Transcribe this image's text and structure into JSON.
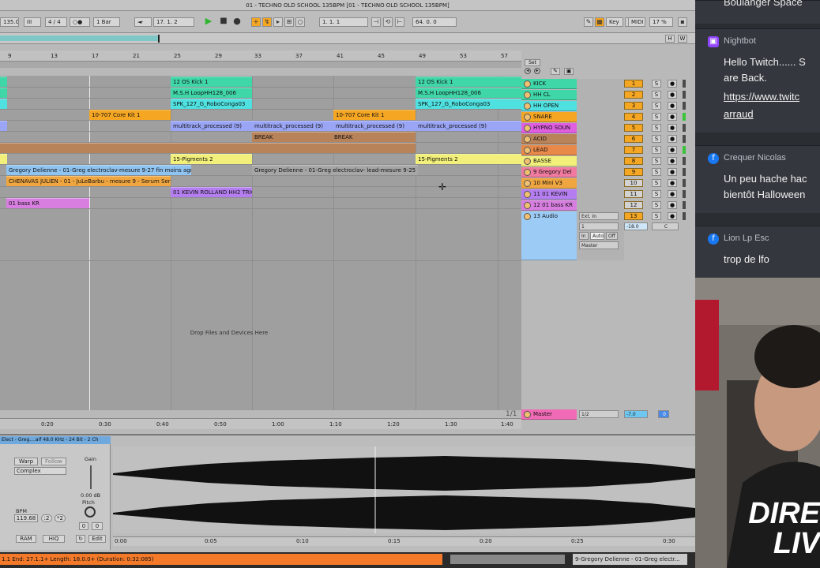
{
  "title": "01 - TECHNO OLD SCHOOL 135BPM  [01 - TECHNO OLD SCHOOL 135BPM]",
  "transport": {
    "tempo": "135.00",
    "signature": "4 / 4",
    "quantize": "1 Bar",
    "position": "17.  1.  2",
    "loop_start": "1.  1.  1",
    "loop_length": "64.  0.  0",
    "key_label": "Key",
    "midi_label": "MIDI",
    "cpu": "17 %",
    "h_label": "H",
    "w_label": "W",
    "play_icon": "play-icon",
    "stop_icon": "stop-icon",
    "record_icon": "record-icon"
  },
  "ruler": [
    "9",
    "13",
    "17",
    "21",
    "25",
    "29",
    "33",
    "37",
    "41",
    "45",
    "49",
    "53",
    "57"
  ],
  "set_label": "Set",
  "clips": [
    {
      "text": "12 OS Kick 1",
      "color": "#3fd6a8"
    },
    {
      "text": "12 OS Kick 1",
      "color": "#3fd6a8"
    },
    {
      "text": "M.S.H LoopHH128_006",
      "color": "#3fd6a8"
    },
    {
      "text": "M.S.H LoopHH128_006",
      "color": "#3fd6a8"
    },
    {
      "text": "SPK_127_G_RoboConga03",
      "color": "#4fe0e0"
    },
    {
      "text": "SPK_127_G_RoboConga03",
      "color": "#4fe0e0"
    },
    {
      "text": "10-707 Core Kit 1",
      "color": "#f5a623"
    },
    {
      "text": "10-707 Core Kit 1",
      "color": "#f5a623"
    },
    {
      "text": "multitrack_processed (9)",
      "color": "#9aa5f5"
    },
    {
      "text": "multitrack_processed (9)",
      "color": "#9aa5f5"
    },
    {
      "text": "multitrack_processed (9)",
      "color": "#9aa5f5"
    },
    {
      "text": "multitrack_processed (9)",
      "color": "#9aa5f5"
    },
    {
      "text": "BREAK",
      "color": "#b9835a"
    },
    {
      "text": "BREAK",
      "color": "#b9835a"
    },
    {
      "text": "15-Pigments 2",
      "color": "#f2f07a"
    },
    {
      "text": "15-Pigments 2",
      "color": "#f2f07a"
    },
    {
      "text": "Gregory Delienne - 01-Greg electroclav-mesure 9-27 fin moins agr",
      "color": "#8fc3f0"
    },
    {
      "text": "Gregory Delienne - 01-Greg electroclav- lead-mesure 9-25",
      "color": "#b5b5b5"
    },
    {
      "text": "CHENAVAS JULIEN - 01 - JuLeBarbu - mesure 9 - Serum Ser",
      "color": "#f0a640"
    },
    {
      "text": "01 KEVIN ROLLAND HH2 TRIG",
      "color": "#b47ef0"
    },
    {
      "text": "01 bass KR",
      "color": "#d77ee0"
    }
  ],
  "drop_text": "Drop Files and Devices Here",
  "tracks": [
    {
      "name": "KICK",
      "num": "1",
      "color": "#3fd6a8"
    },
    {
      "name": "HH CL",
      "num": "2",
      "color": "#3fd6a8"
    },
    {
      "name": "HH OPEN",
      "num": "3",
      "color": "#4fe0e0"
    },
    {
      "name": "SNARE",
      "num": "4",
      "color": "#f5a623"
    },
    {
      "name": "HYPNO SOUN",
      "num": "5",
      "color": "#e05fe0"
    },
    {
      "name": "ACID",
      "num": "6",
      "color": "#b9835a"
    },
    {
      "name": "LEAD",
      "num": "7",
      "color": "#e8894a"
    },
    {
      "name": "BASSE",
      "num": "8",
      "color": "#f2f07a"
    },
    {
      "name": "9 Gregory Del",
      "num": "9",
      "color": "#f07aa0"
    },
    {
      "name": "10 Mini V3",
      "num": "10",
      "color": "#f0a640"
    },
    {
      "name": "11 01 KEVIN",
      "num": "11",
      "color": "#b47ef0"
    },
    {
      "name": "12 01 bass KR",
      "num": "12",
      "color": "#d77ee0"
    },
    {
      "name": "13 Audio",
      "num": "13",
      "color": "#9ccbf5"
    }
  ],
  "audio_track": {
    "input": "Ext. In",
    "channel": "1",
    "in_label": "In",
    "auto_label": "Auto",
    "off_label": "Off",
    "output": "Master",
    "volume": "-18.0",
    "pan": "C"
  },
  "master": {
    "name": "Master",
    "fraction": "1/1",
    "routing": "1/2",
    "volume": "-7.0",
    "num": "0"
  },
  "solo_label": "S",
  "timeline": [
    "0:20",
    "0:30",
    "0:40",
    "0:50",
    "1:00",
    "1:10",
    "1:20",
    "1:30",
    "1:40"
  ],
  "clip_view": {
    "title": "Elect - Greg....aif  48.0 KHz - 24 Bit - 2 Ch",
    "warp": "Warp",
    "follow": "Follow",
    "mode": "Complex",
    "gain_label": "Gain",
    "gain_value": "0.00 dB",
    "pitch_label": "Pitch",
    "bpm_label": "BPM",
    "bpm_value": "119.68",
    "half": ":2",
    "double": "*2",
    "pitch_semi": "0",
    "pitch_cents": "0",
    "ram": "RAM",
    "hiq": "HiQ",
    "edit": "Edit"
  },
  "wave_times": [
    "0:00",
    "0:05",
    "0:10",
    "0:15",
    "0:20",
    "0:25",
    "0:30"
  ],
  "status": {
    "left": "1.1    End: 27.1.1+   Length: 18.0.0+ (Duration: 0:32:085)",
    "right": "9-Gregory Delienne - 01-Greg electr..."
  },
  "chat": [
    {
      "user": "Boulanger Space",
      "text": "",
      "icon": "user-icon",
      "color": "#3b82f6"
    },
    {
      "user": "Nightbot",
      "text": "Hello Twitch...... S\nare Back.",
      "link": "https://www.twitc",
      "link2": "arraud",
      "icon": "twitch-icon",
      "color": "#9146ff"
    },
    {
      "user": "Crequer Nicolas",
      "text": "Un peu hache hac\nbientôt Halloween",
      "icon": "facebook-icon",
      "color": "#1877f2"
    },
    {
      "user": "Lion Lp Esc",
      "text": "trop de lfo",
      "icon": "facebook-icon",
      "color": "#1877f2"
    }
  ],
  "overlay": {
    "line1": "DIRE",
    "line2": "LIV"
  }
}
